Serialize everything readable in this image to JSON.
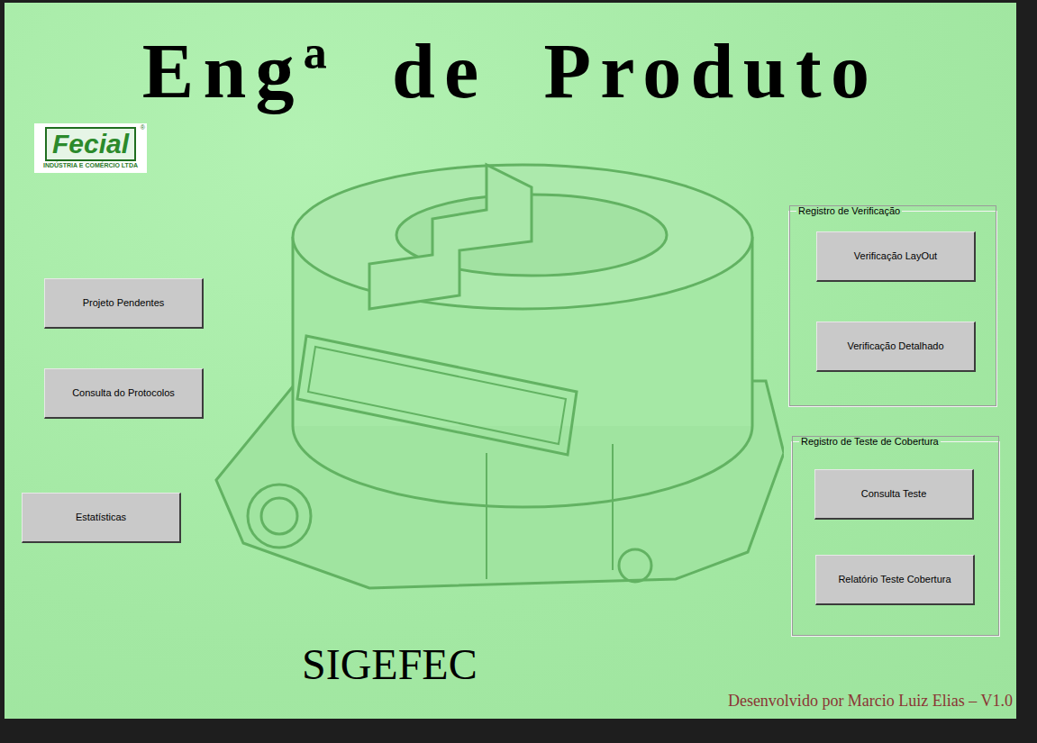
{
  "window": {
    "title": "Engª de Produto"
  },
  "logo": {
    "name": "Fecial",
    "subtitle": "INDÚSTRIA E COMÉRCIO LTDA",
    "mark": "®"
  },
  "left_buttons": [
    "Projeto Pendentes",
    "Consulta do Protocolos",
    "Estatísticas"
  ],
  "groups": [
    {
      "title": "Registro de Verificação",
      "buttons": [
        "Verificação LayOut",
        "Verificação Detalhado"
      ]
    },
    {
      "title": "Registro de Teste de Cobertura",
      "buttons": [
        "Consulta Teste",
        "Relatório Teste Cobertura"
      ]
    }
  ],
  "app_name": "SIGEFEC",
  "footer": "Desenvolvido por Marcio Luiz Elias – V1.0"
}
